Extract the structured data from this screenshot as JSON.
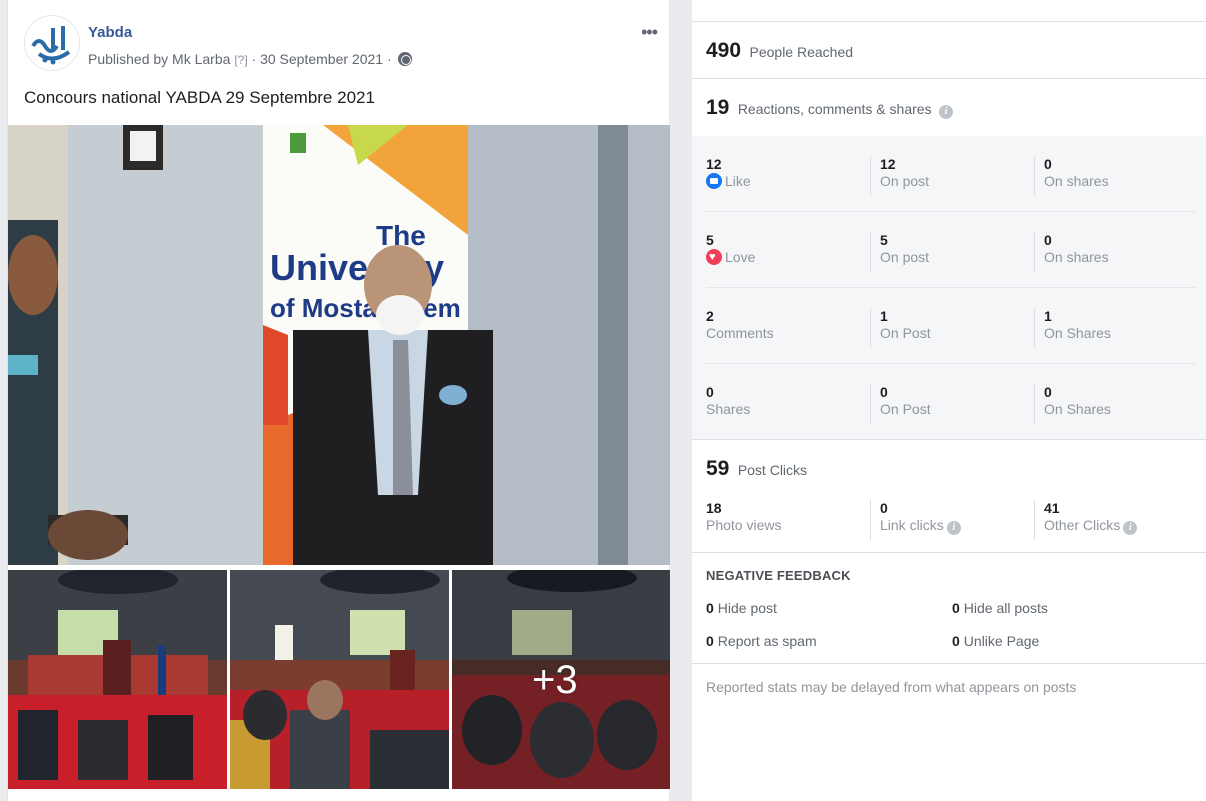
{
  "post": {
    "page_name": "Yabda",
    "published_prefix": "Published by Mk Larba",
    "help_marker": "[?]",
    "date": "· 30 September 2021 ·",
    "more_icon": "more-options-icon",
    "text": "Concours national YABDA 29 Septembre 2021",
    "banner_the": "The",
    "banner_univ": "University",
    "banner_mosta": "of Mostaganem",
    "more_photos": "+3"
  },
  "insights": {
    "reach": {
      "value": "490",
      "label": "People Reached"
    },
    "engagement": {
      "value": "19",
      "label": "Reactions, comments & shares"
    },
    "rows": [
      {
        "total": "12",
        "label": "Like",
        "post": "12",
        "post_label": "On post",
        "shares": "0",
        "shares_label": "On shares"
      },
      {
        "total": "5",
        "label": "Love",
        "post": "5",
        "post_label": "On post",
        "shares": "0",
        "shares_label": "On shares"
      },
      {
        "total": "2",
        "label": "Comments",
        "post": "1",
        "post_label": "On Post",
        "shares": "1",
        "shares_label": "On Shares"
      },
      {
        "total": "0",
        "label": "Shares",
        "post": "0",
        "post_label": "On Post",
        "shares": "0",
        "shares_label": "On Shares"
      }
    ],
    "clicks": {
      "value": "59",
      "label": "Post Clicks",
      "photo_views": {
        "value": "18",
        "label": "Photo views"
      },
      "link_clicks": {
        "value": "0",
        "label": "Link clicks"
      },
      "other_clicks": {
        "value": "41",
        "label": "Other Clicks"
      }
    },
    "negative": {
      "title": "NEGATIVE FEEDBACK",
      "hide_post": {
        "value": "0",
        "label": "Hide post"
      },
      "hide_all": {
        "value": "0",
        "label": "Hide all posts"
      },
      "spam": {
        "value": "0",
        "label": "Report as spam"
      },
      "unlike": {
        "value": "0",
        "label": "Unlike Page"
      }
    },
    "footer": "Reported stats may be delayed from what appears on posts"
  },
  "colors": {
    "link": "#385898",
    "like": "#1877f2",
    "love": "#f33e58"
  }
}
